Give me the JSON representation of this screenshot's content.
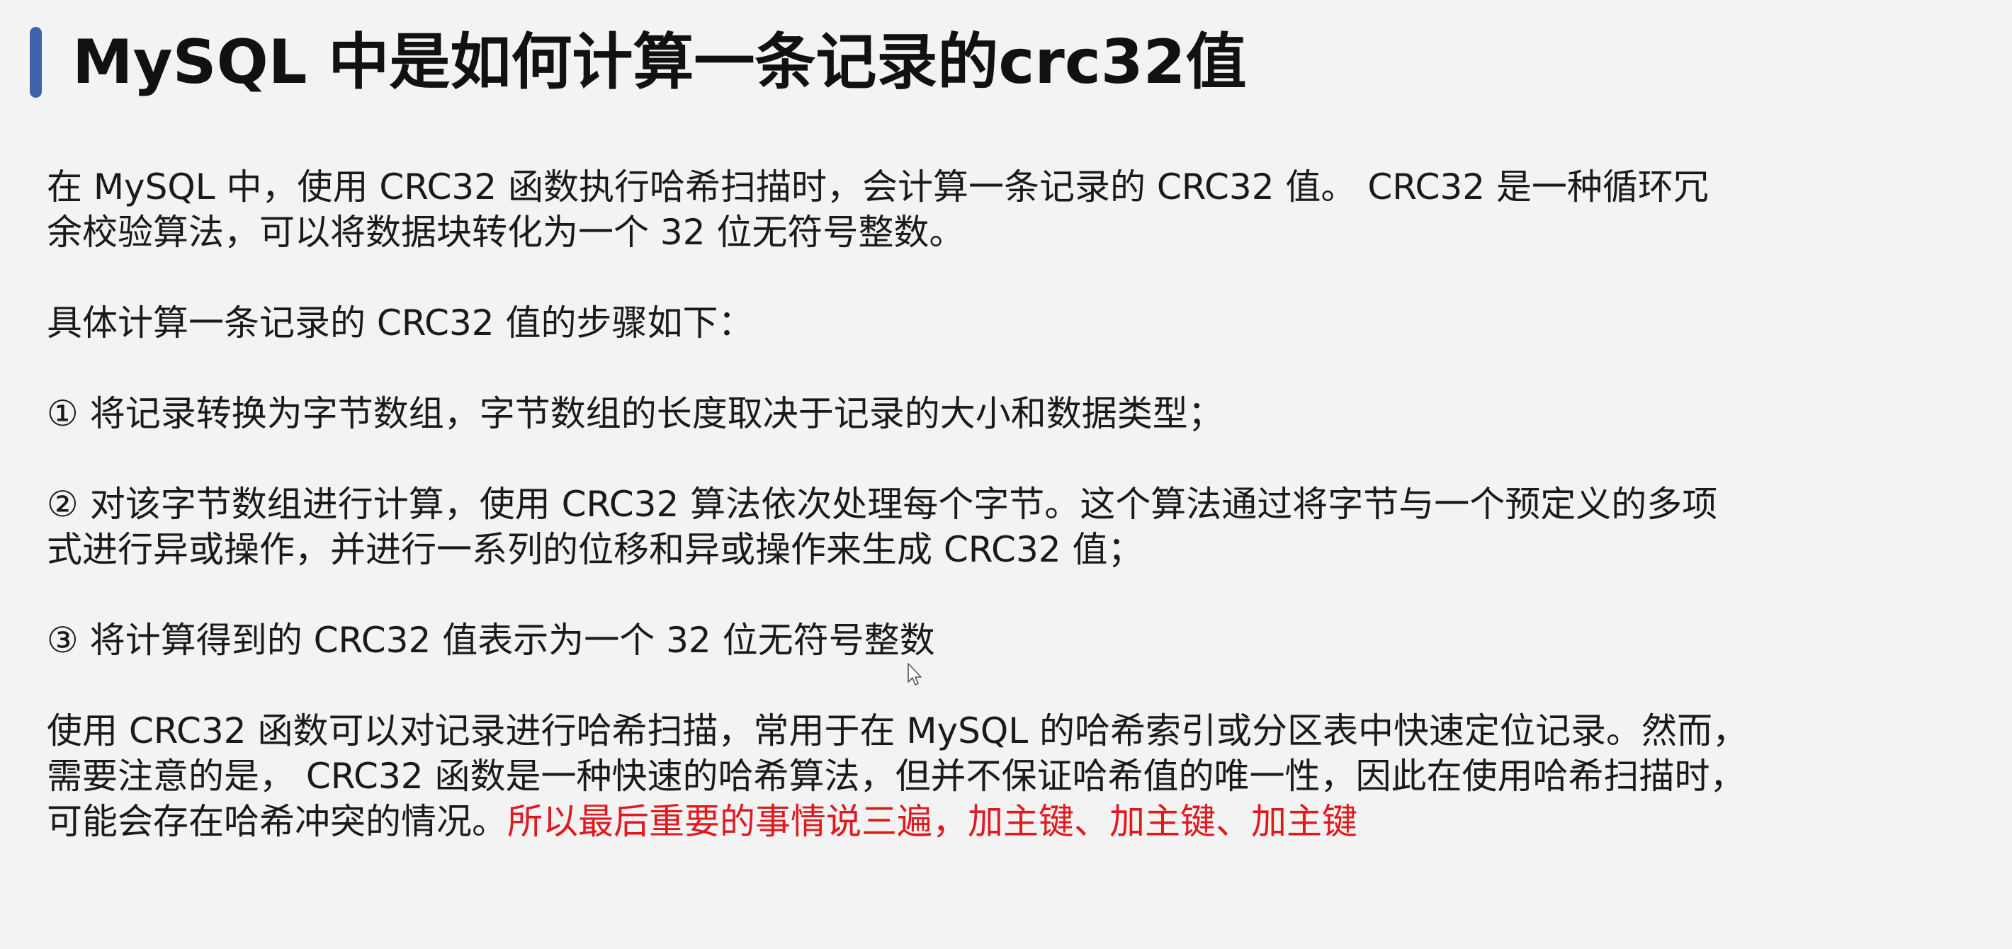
{
  "title": "MySQL 中是如何计算一条记录的crc32值",
  "paragraphs": {
    "intro_line1": "在 MySQL 中，使用 CRC32 函数执行哈希扫描时，会计算一条记录的 CRC32 值。 CRC32 是一种循环冗",
    "intro_line2": "余校验算法，可以将数据块转化为一个 32 位无符号整数。",
    "steps_heading": "具体计算一条记录的 CRC32 值的步骤如下：",
    "step1": "① 将记录转换为字节数组，字节数组的长度取决于记录的大小和数据类型；",
    "step2_line1": "② 对该字节数组进行计算，使用 CRC32 算法依次处理每个字节。这个算法通过将字节与一个预定义的多项",
    "step2_line2": "式进行异或操作，并进行一系列的位移和异或操作来生成 CRC32 值；",
    "step3": "③ 将计算得到的 CRC32 值表示为一个 32 位无符号整数",
    "conclusion_line1": "使用 CRC32 函数可以对记录进行哈希扫描，常用于在 MySQL 的哈希索引或分区表中快速定位记录。然而，",
    "conclusion_line2": "需要注意的是， CRC32 函数是一种快速的哈希算法，但并不保证哈希值的唯一性，因此在使用哈希扫描时，",
    "conclusion_line3_plain": "可能会存在哈希冲突的情况。",
    "conclusion_line3_emphasis": "所以最后重要的事情说三遍，加主键、加主键、加主键"
  },
  "colors": {
    "accent_bar": "#3f63a8",
    "emphasis": "#e0191f",
    "background": "#f3f3f3"
  },
  "icons": {
    "cursor": "mouse-pointer-icon"
  }
}
